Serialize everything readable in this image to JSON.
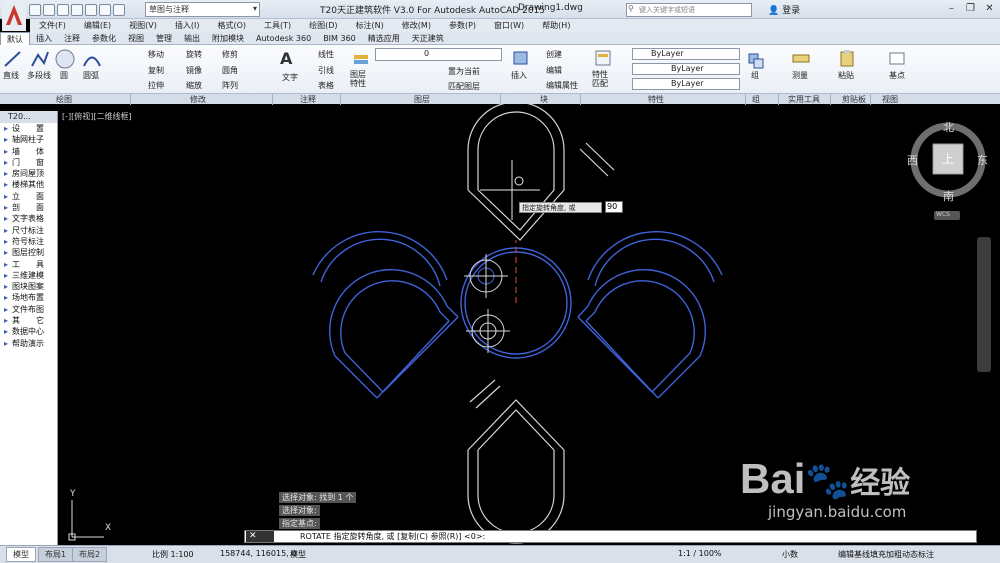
{
  "title_bar": {
    "app_title": "T20天正建筑软件 V3.0 For Autodesk AutoCAD 2015",
    "doc_title": "Drawing1.dwg",
    "workspace": "草图与注释",
    "search_placeholder": "键入关键字或短语",
    "login": "登录"
  },
  "menubar": [
    "文件(F)",
    "编辑(E)",
    "视图(V)",
    "插入(I)",
    "格式(O)",
    "工具(T)",
    "绘图(D)",
    "标注(N)",
    "修改(M)",
    "参数(P)",
    "窗口(W)",
    "帮助(H)"
  ],
  "ribbon_tabs": [
    "默认",
    "插入",
    "注释",
    "参数化",
    "视图",
    "管理",
    "输出",
    "附加模块",
    "Autodesk 360",
    "BIM 360",
    "精选应用",
    "天正建筑"
  ],
  "ribbon": {
    "draw": [
      "直线",
      "多段线",
      "圆",
      "圆弧"
    ],
    "modify": [
      "移动",
      "旋转",
      "修剪",
      "复制",
      "镜像",
      "圆角",
      "拉伸",
      "缩放",
      "阵列"
    ],
    "annotation": [
      "文字",
      "线性",
      "引线",
      "表格"
    ],
    "layers": [
      "图层特性",
      "0",
      "置为当前",
      "匹配图层"
    ],
    "block": [
      "插入",
      "创建",
      "编辑",
      "编辑属性"
    ],
    "properties": [
      "特性匹配",
      "ByLayer",
      "ByLayer",
      "ByLayer"
    ],
    "groups": [
      "组"
    ],
    "utilities": [
      "测量"
    ],
    "clipboard": [
      "粘贴"
    ],
    "view": [
      "基点"
    ]
  },
  "panels": [
    "绘图",
    "修改",
    "注释",
    "图层",
    "块",
    "特性",
    "组",
    "实用工具",
    "剪贴板",
    "视图"
  ],
  "sidebar": {
    "header": "T20...",
    "items": [
      "设　　置",
      "轴网柱子",
      "墙　　体",
      "门　　窗",
      "房间屋顶",
      "楼梯其他",
      "立　　面",
      "剖　　面",
      "文字表格",
      "尺寸标注",
      "符号标注",
      "图层控制",
      "工　　具",
      "三维建模",
      "图块图案",
      "场地布置",
      "文件布图",
      "其　　它",
      "数据中心",
      "帮助演示"
    ]
  },
  "viewport": {
    "label": "[-][俯视][二维线框]",
    "compass": {
      "north": "北",
      "south": "南",
      "east": "东",
      "west": "西",
      "center": "上",
      "wcs": "WCS"
    },
    "ucs": {
      "x": "X",
      "y": "Y"
    }
  },
  "tooltip": {
    "prompt": "指定旋转角度, 或",
    "value": "90"
  },
  "command": {
    "history": [
      "选择对象: 找到 1 个",
      "选择对象:",
      "指定基点:"
    ],
    "line": "ROTATE 指定旋转角度, 或 [复制(C) 参照(R)] <0>:"
  },
  "status": {
    "tabs": [
      "模型",
      "布局1",
      "布局2"
    ],
    "scale": "比例 1:100",
    "coords": "158744, 116015, 0",
    "model": "模型",
    "zoom": "1:1 / 100%",
    "units": "小数",
    "extra": "编辑基线填充加粗动态标注"
  },
  "watermark": {
    "brand": "Bai",
    "brand2": "经验",
    "url": "jingyan.baidu.com"
  },
  "colors": {
    "select": "#3f63d8",
    "line": "#d8d8d8",
    "ribbon": "#e7edf5",
    "red": "#c8372d"
  }
}
